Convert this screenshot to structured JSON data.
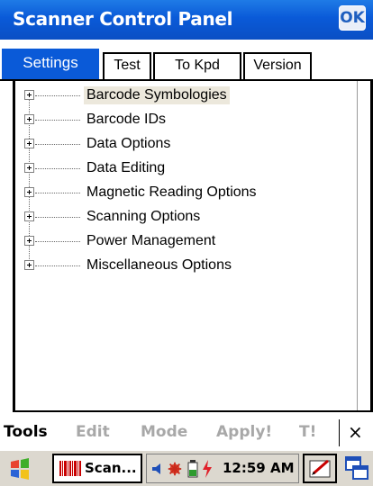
{
  "window": {
    "title": "Scanner Control Panel",
    "ok_label": "OK"
  },
  "tabs": [
    {
      "label": "Settings",
      "active": true
    },
    {
      "label": "Test",
      "active": false
    },
    {
      "label": "To Kpd",
      "active": false
    },
    {
      "label": "Version",
      "active": false
    }
  ],
  "tree": {
    "items": [
      {
        "label": "Barcode Symbologies",
        "selected": true
      },
      {
        "label": "Barcode IDs"
      },
      {
        "label": "Data Options"
      },
      {
        "label": "Data Editing"
      },
      {
        "label": "Magnetic Reading Options"
      },
      {
        "label": "Scanning Options"
      },
      {
        "label": "Power Management"
      },
      {
        "label": "Miscellaneous Options"
      }
    ]
  },
  "menubar": {
    "tools": "Tools",
    "edit": "Edit",
    "mode": "Mode",
    "apply": "Apply!",
    "t": "T!",
    "close": "×"
  },
  "taskbar": {
    "task_label": "Scan...",
    "time": "12:59 AM"
  },
  "colors": {
    "titlebar": "#0a5ad8",
    "selection": "#ece8dc",
    "disabled_text": "#a8a8a8",
    "taskbar": "#dcd8cf"
  }
}
